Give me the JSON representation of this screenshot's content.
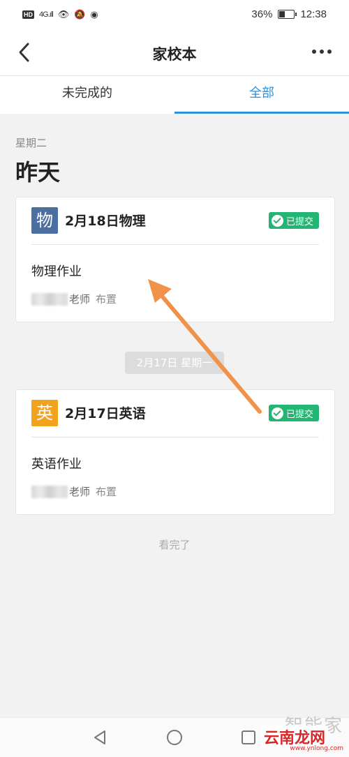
{
  "status_bar": {
    "left_label": "HD",
    "network": "4G",
    "battery": "36%",
    "battery_level": 0.36,
    "time": "12:38"
  },
  "header": {
    "title": "家校本"
  },
  "tabs": [
    {
      "label": "未完成的",
      "active": false
    },
    {
      "label": "全部",
      "active": true
    }
  ],
  "day_group": {
    "weekday": "星期二",
    "title": "昨天"
  },
  "cards": [
    {
      "subject_icon_text": "物",
      "title": "2月18日物理",
      "badge": "已提交",
      "homework": "物理作业",
      "teacher_suffix": "老师",
      "action": "布置"
    },
    {
      "subject_icon_text": "英",
      "title": "2月17日英语",
      "badge": "已提交",
      "homework": "英语作业",
      "teacher_suffix": "老师",
      "action": "布置"
    }
  ],
  "date_separator": "2月17日 星期一",
  "end_text": "看完了",
  "watermarks": {
    "top": "智能家",
    "main": "云南龙网",
    "sub": "www.ynlong.com"
  },
  "colors": {
    "accent": "#2f8fd8",
    "submitted": "#22b573",
    "physics_icon": "#4a6fa0",
    "english_icon": "#f2a21c",
    "arrow": "#f0924a"
  }
}
